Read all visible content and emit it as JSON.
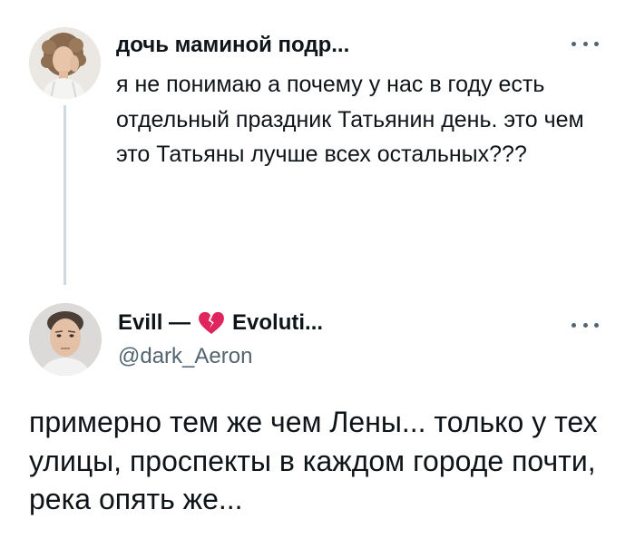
{
  "tweets": [
    {
      "author_name": "дочь маминой подр...",
      "avatar": "woman-with-curly-hair-avatar",
      "text": "я не понимаю а почему у нас в году есть отдельный праздник Татьянин день. это чем это Татьяны лучше всех остальных???",
      "more_icon": "ellipsis-icon"
    },
    {
      "author_name_part1": "Evill —",
      "author_emoji": "broken-heart-icon",
      "author_name_part2": "Evoluti...",
      "handle": "@dark_Aeron",
      "avatar": "man-portrait-avatar",
      "text": "примерно тем же чем Лены... только у тех улицы, проспекты в каждом городе почти, река опять же...",
      "more_icon": "ellipsis-icon"
    }
  ],
  "colors": {
    "text": "#0f1419",
    "secondary": "#536471",
    "thread_line": "#cfd9de",
    "heart": "#e0245e"
  }
}
